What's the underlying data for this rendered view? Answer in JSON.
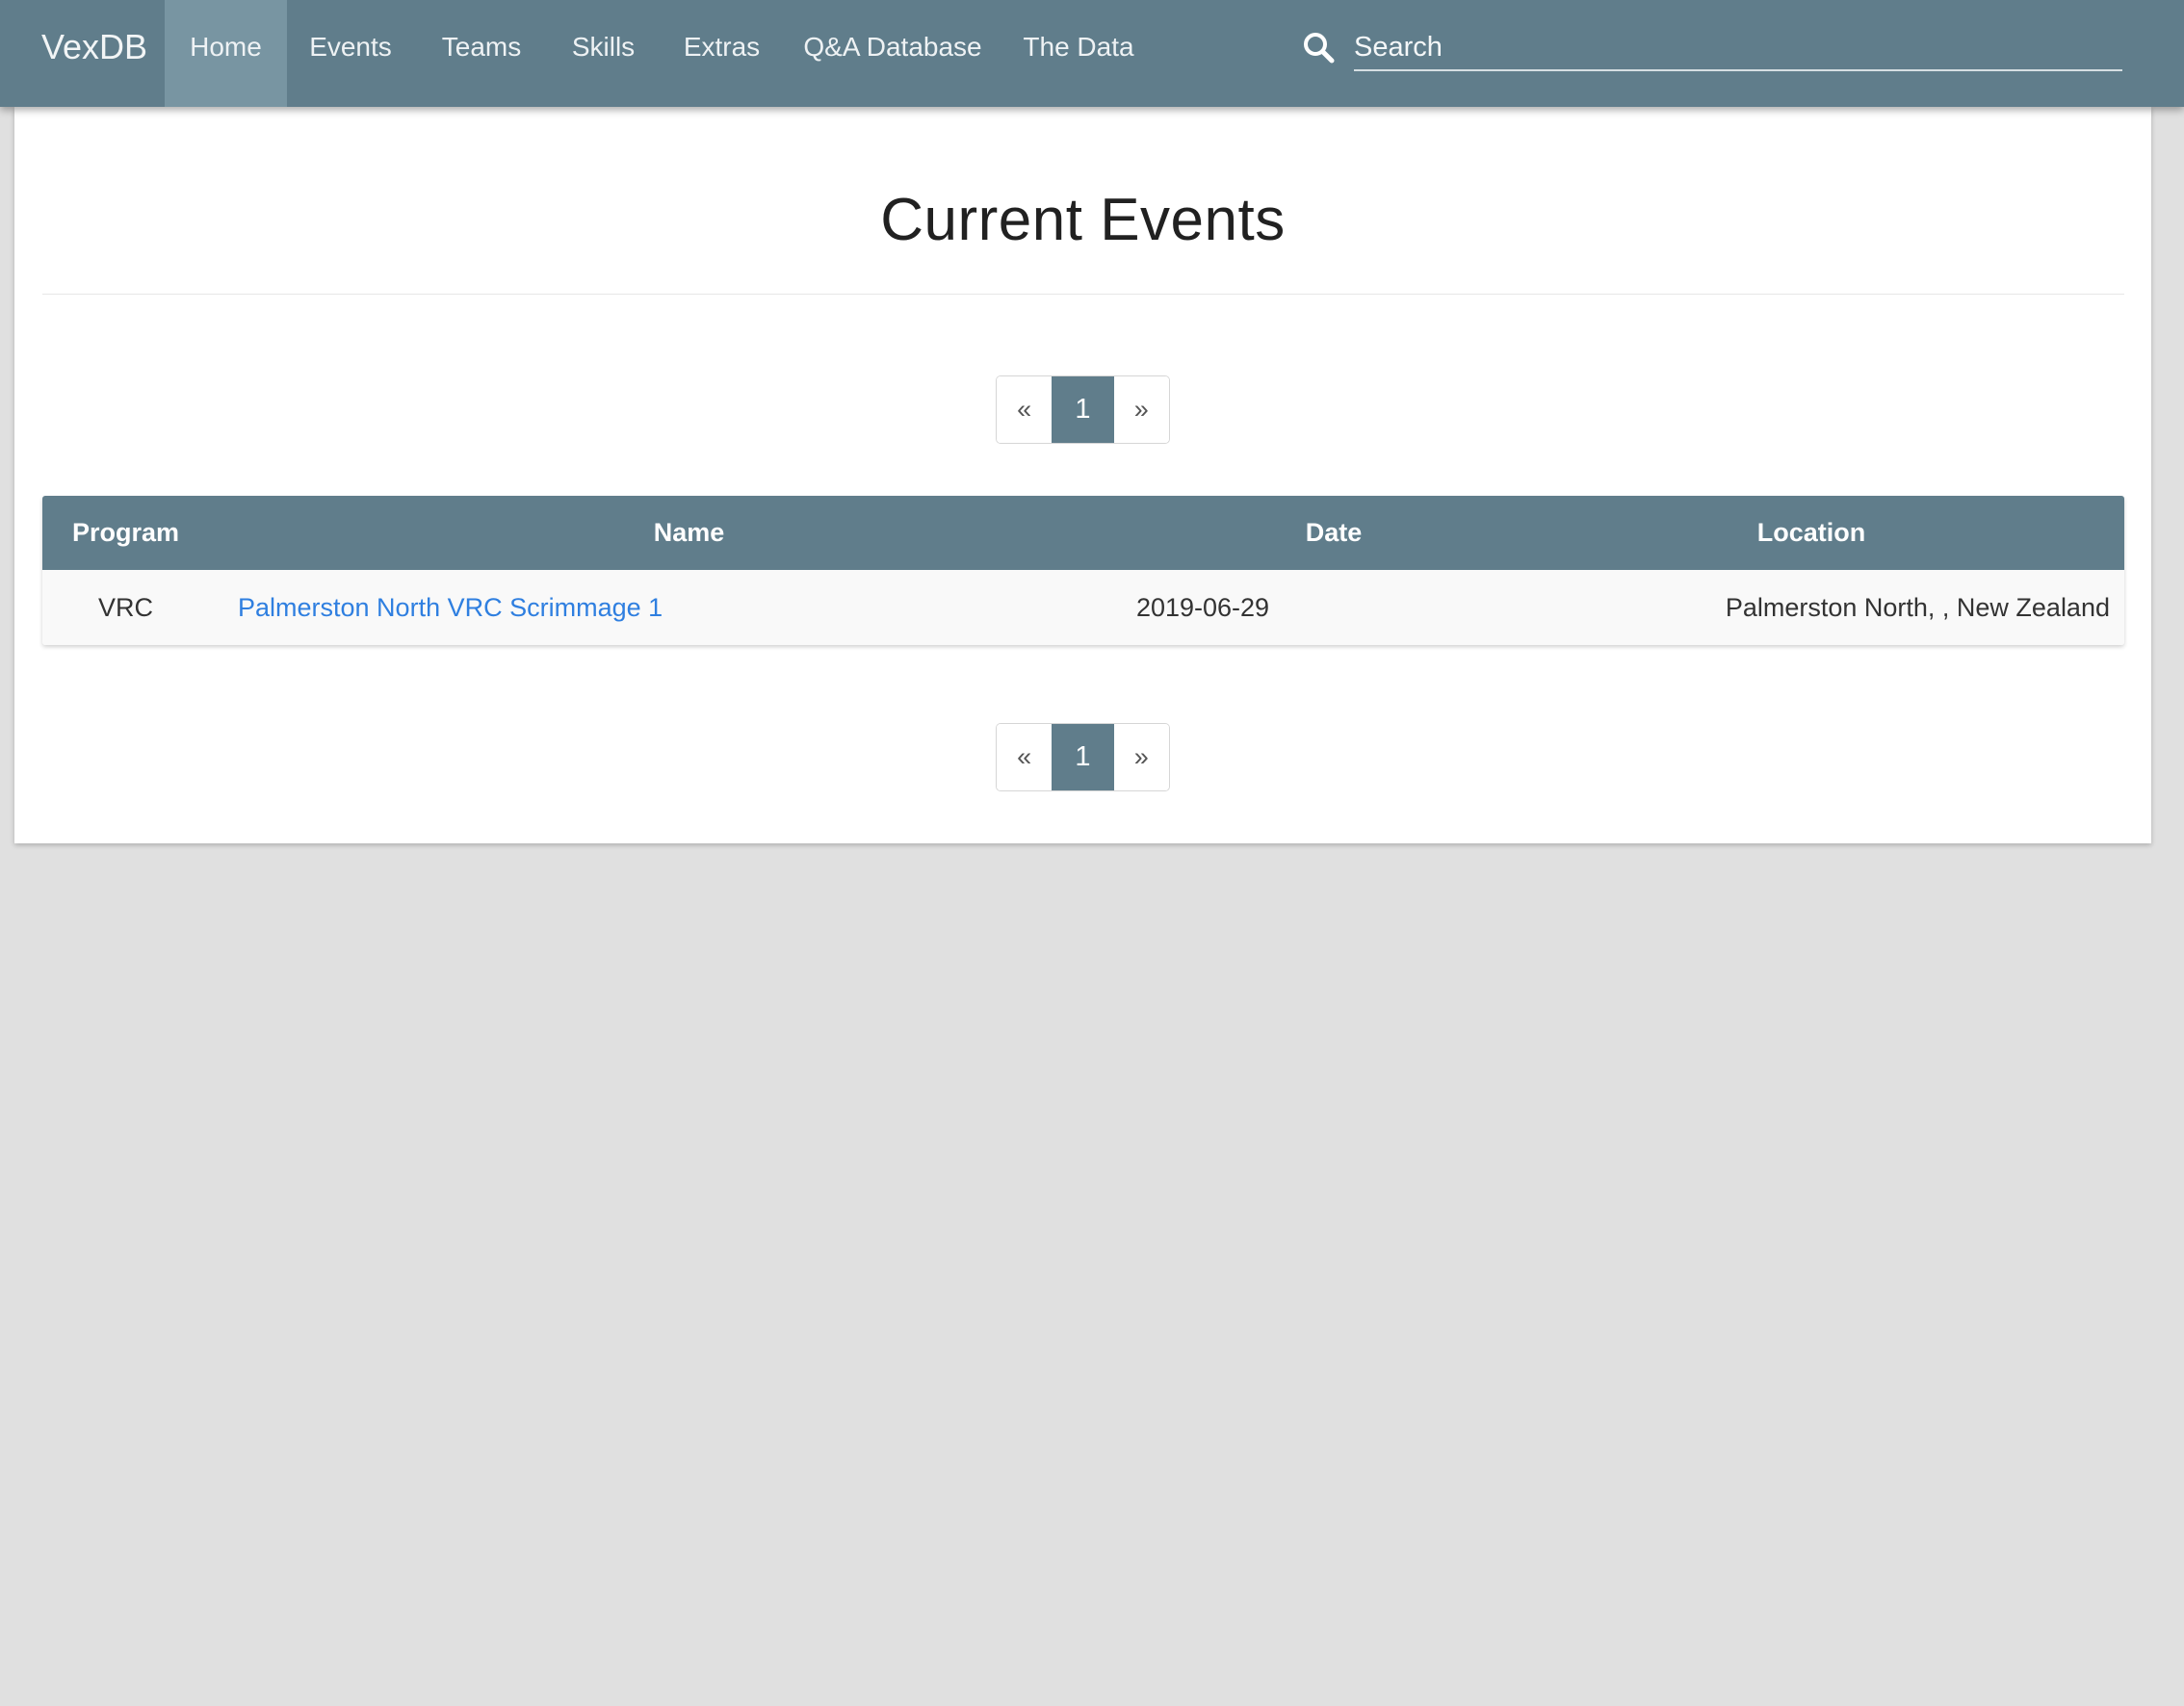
{
  "navbar": {
    "brand": "VexDB",
    "items": [
      {
        "label": "Home",
        "active": true
      },
      {
        "label": "Events",
        "active": false
      },
      {
        "label": "Teams",
        "active": false
      },
      {
        "label": "Skills",
        "active": false
      },
      {
        "label": "Extras",
        "active": false
      },
      {
        "label": "Q&A Database",
        "active": false
      },
      {
        "label": "The Data",
        "active": false
      }
    ],
    "search": {
      "placeholder": "Search",
      "value": "",
      "icon": "search-icon"
    }
  },
  "main": {
    "title": "Current Events",
    "pagination": {
      "prev": "«",
      "current": "1",
      "next": "»"
    },
    "table": {
      "headers": [
        "Program",
        "Name",
        "Date",
        "Location"
      ],
      "rows": [
        {
          "program": "VRC",
          "name": "Palmerston North VRC Scrimmage 1",
          "date": "2019-06-29",
          "location": "Palmerston North, , New Zealand"
        }
      ]
    }
  },
  "colors": {
    "primary": "#607d8b",
    "active_nav": "#7895a2",
    "link": "#2f7fe0",
    "background": "#e0e0e0"
  }
}
